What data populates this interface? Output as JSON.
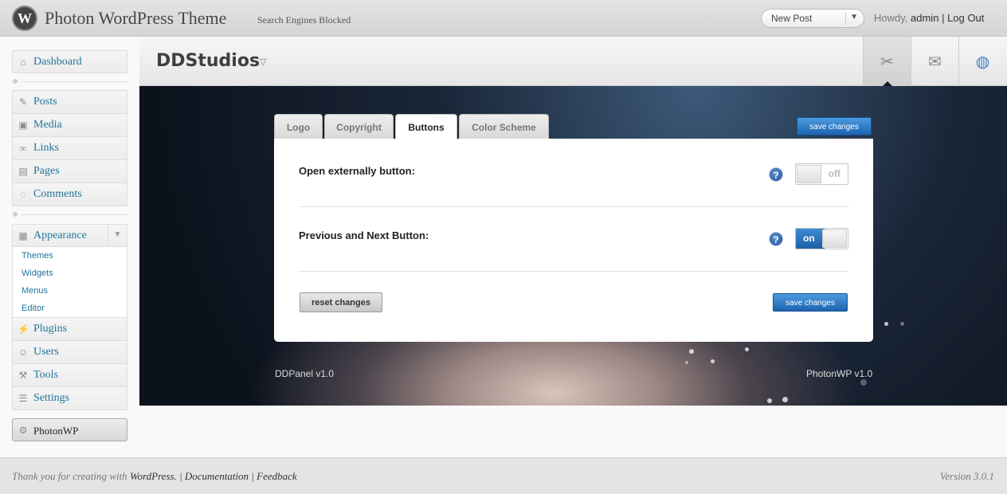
{
  "topbar": {
    "logo_letter": "W",
    "site_title": "Photon WordPress Theme",
    "site_subtitle": "Search Engines Blocked",
    "new_post_label": "New Post",
    "howdy": "Howdy,",
    "user": "admin",
    "separator": "|",
    "logout": "Log Out"
  },
  "menu": {
    "dashboard": "Dashboard",
    "posts": "Posts",
    "media": "Media",
    "links": "Links",
    "pages": "Pages",
    "comments": "Comments",
    "appearance": "Appearance",
    "appearance_sub": [
      "Themes",
      "Widgets",
      "Menus",
      "Editor"
    ],
    "plugins": "Plugins",
    "users": "Users",
    "tools": "Tools",
    "settings": "Settings",
    "photonwp": "PhotonWP"
  },
  "header": {
    "title": "DDStudios",
    "icons": [
      "tools-icon",
      "mail-icon",
      "globe-icon"
    ]
  },
  "panel": {
    "tabs": [
      "Logo",
      "Copyright",
      "Buttons",
      "Color Scheme"
    ],
    "active_tab": "Buttons",
    "save_label": "save changes",
    "options": [
      {
        "label": "Open externally button:",
        "state": "off"
      },
      {
        "label": "Previous and Next Button:",
        "state": "on"
      }
    ],
    "help_glyph": "?",
    "reset_label": "reset changes",
    "footer_left": "DDPanel v1.0",
    "footer_right": "PhotonWP v1.0"
  },
  "footer": {
    "thanks": "Thank you for creating with",
    "wordpress": "WordPress.",
    "sep": "|",
    "documentation": "Documentation",
    "feedback": "Feedback",
    "version": "Version 3.0.1"
  },
  "colors": {
    "link": "#21759b",
    "accent_blue": "#1d64b0",
    "panel_bg": "#0c121c"
  }
}
